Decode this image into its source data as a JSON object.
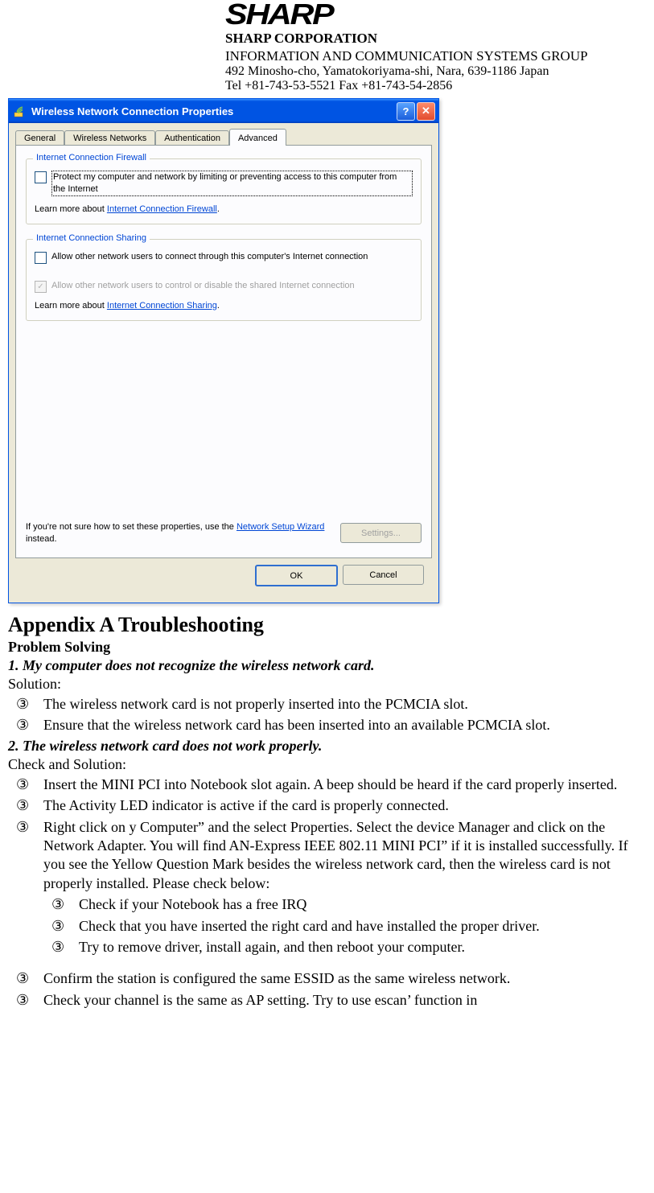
{
  "letterhead": {
    "logo": "SHARP",
    "corp": "SHARP CORPORATION",
    "group": "INFORMATION AND COMMUNICATION SYSTEMS GROUP",
    "addr": "492 Minosho-cho, Yamatokoriyama-shi, Nara, 639-1186 Japan",
    "tel": "Tel +81-743-53-5521 Fax +81-743-54-2856"
  },
  "dialog": {
    "title": "Wireless Network Connection Properties",
    "tabs": {
      "general": "General",
      "wireless": "Wireless Networks",
      "auth": "Authentication",
      "advanced": "Advanced"
    },
    "group_firewall": {
      "title": "Internet Connection Firewall",
      "chk_label": "Protect my computer and network by limiting or preventing access to this computer from the Internet",
      "learn_prefix": "Learn more about ",
      "learn_link": "Internet Connection Firewall",
      "learn_suffix": "."
    },
    "group_sharing": {
      "title": "Internet Connection Sharing",
      "chk1_label": "Allow other network users to connect through this computer's Internet connection",
      "chk2_label": "Allow other network users to control or disable the shared Internet connection",
      "learn_prefix": "Learn more about ",
      "learn_link": "Internet Connection Sharing",
      "learn_suffix": "."
    },
    "wizard": {
      "text_a": "If you're not sure how to set these properties, use the ",
      "link": "Network Setup Wizard",
      "text_b": " instead.",
      "settings_btn": "Settings..."
    },
    "buttons": {
      "ok": "OK",
      "cancel": "Cancel"
    }
  },
  "doc": {
    "appendix": "Appendix A    Troubleshooting",
    "problem_solving": "Problem Solving",
    "p1_title": "1. My computer does not recognize the wireless network card.",
    "solution": "Solution:",
    "p1_b1": "The wireless network card is not properly inserted into the PCMCIA slot.",
    "p1_b2": "Ensure that the wireless network card has been inserted into an available PCMCIA slot.",
    "p2_title": "2. The wireless network card does not work properly.",
    "check_solution": "Check and Solution:",
    "p2_b1": "Insert the MINI PCI into Notebook      slot again. A beep should be heard if the card properly inserted.",
    "p2_b2": "The Activity LED indicator is active if the card is properly connected.",
    "p2_b3": "Right click on      y Computer” and the select Properties. Select the device Manager and click on the Network Adapter. You will find      AN-Express IEEE 802.11 MINI PCI” if it is installed successfully. If you see the Yellow Question Mark besides the wireless network card, then the wireless card is not properly installed. Please check below:",
    "p2_b3a": "Check if your Notebook has a free IRQ",
    "p2_b3b": "Check that you have inserted the right card and have installed the proper driver.",
    "p2_b3c": "Try to remove driver, install again, and then reboot your computer.",
    "p2_b4": "Confirm the station is configured the same ESSID as the same wireless network.",
    "p2_b5": "Check your channel is the same as AP setting. Try to use      escan’ function in"
  }
}
